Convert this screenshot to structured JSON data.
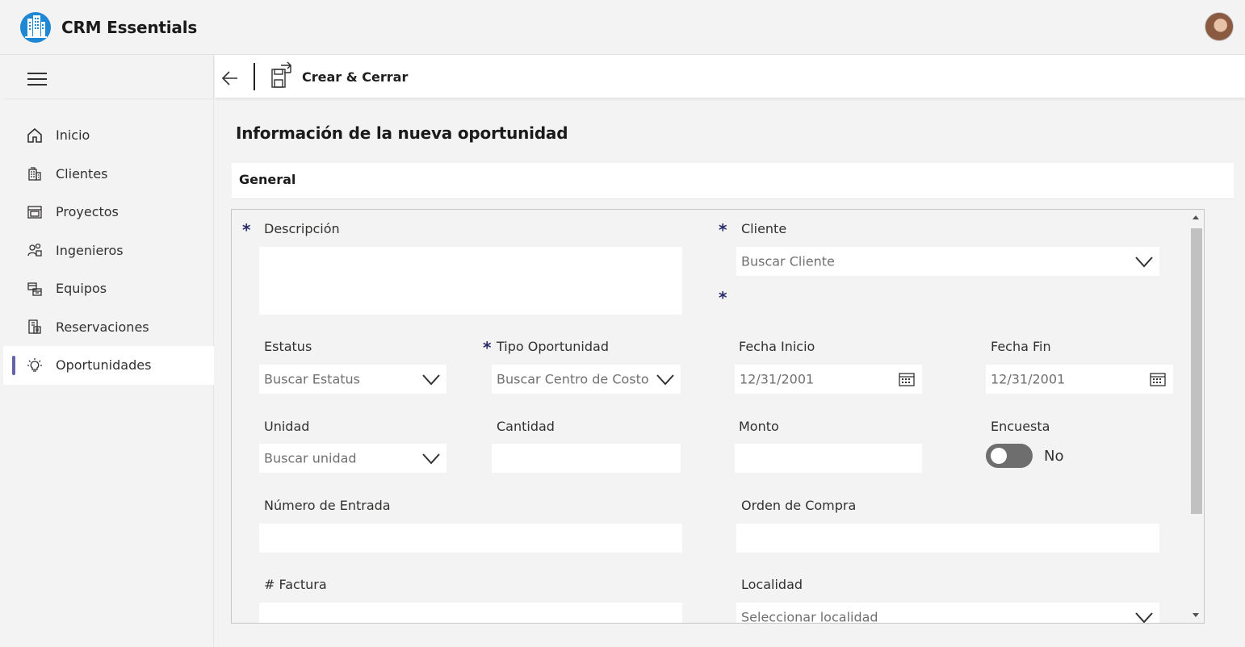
{
  "app": {
    "title": "CRM Essentials",
    "logo_icon": "building-logo-icon",
    "accent": "#6264a7",
    "logo_color": "#1e88d4"
  },
  "sidebar": {
    "items": [
      {
        "label": "Inicio",
        "icon": "home-icon",
        "active": false
      },
      {
        "label": "Clientes",
        "icon": "building-icon",
        "active": false
      },
      {
        "label": "Proyectos",
        "icon": "folder-icon",
        "active": false
      },
      {
        "label": "Ingenieros",
        "icon": "people-icon",
        "active": false
      },
      {
        "label": "Equipos",
        "icon": "equipment-icon",
        "active": false
      },
      {
        "label": "Reservaciones",
        "icon": "reservation-icon",
        "active": false
      },
      {
        "label": "Oportunidades",
        "icon": "lightbulb-icon",
        "active": true
      }
    ]
  },
  "commandbar": {
    "save_close_label": "Crear & Cerrar"
  },
  "main": {
    "title": "Información de la nueva oportunidad",
    "section": "General"
  },
  "form": {
    "required_mark": "*",
    "descripcion_label": "Descripción",
    "cliente_label": "Cliente",
    "cliente_placeholder": "Buscar Cliente",
    "estatus_label": "Estatus",
    "estatus_placeholder": "Buscar Estatus",
    "tipo_label": "Tipo Oportunidad",
    "tipo_placeholder": "Buscar Centro de Costo",
    "fecha_inicio_label": "Fecha Inicio",
    "fecha_inicio_value": "12/31/2001",
    "fecha_fin_label": "Fecha Fin",
    "fecha_fin_value": "12/31/2001",
    "unidad_label": "Unidad",
    "unidad_placeholder": "Buscar unidad",
    "cantidad_label": "Cantidad",
    "monto_label": "Monto",
    "encuesta_label": "Encuesta",
    "encuesta_value": "No",
    "numero_entrada_label": "Número de Entrada",
    "orden_compra_label": "Orden de Compra",
    "factura_label": "# Factura",
    "localidad_label": "Localidad",
    "localidad_placeholder": "Seleccionar localidad"
  }
}
